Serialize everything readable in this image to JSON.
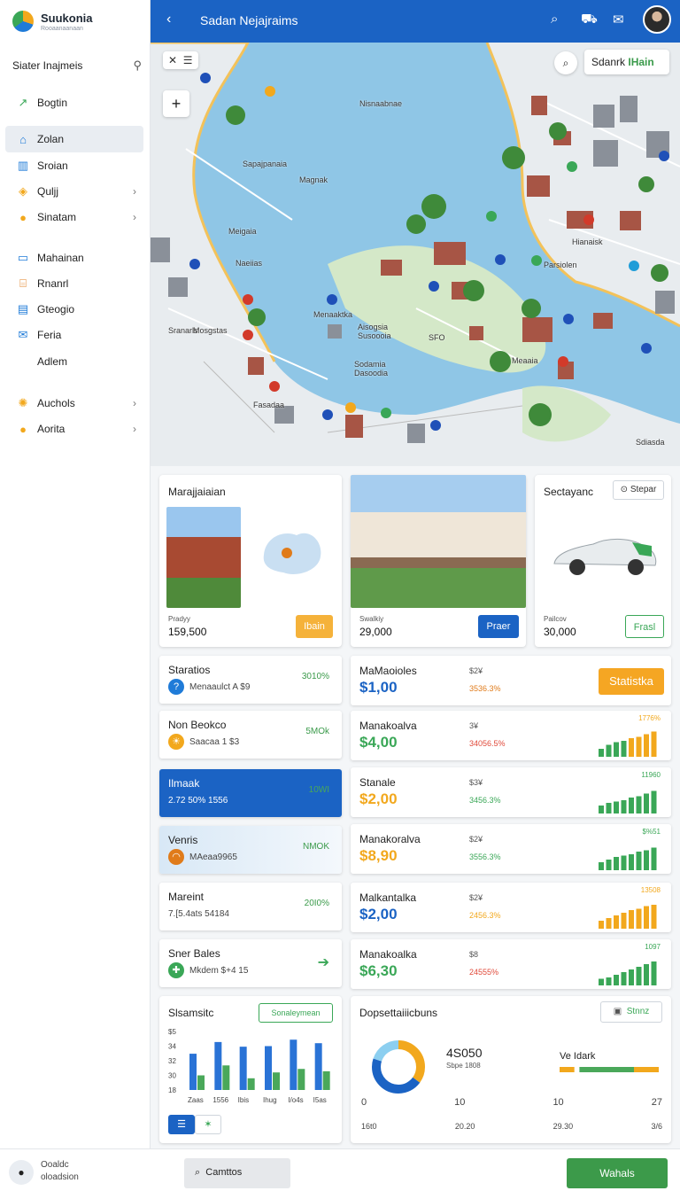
{
  "app": {
    "name": "Suukonia",
    "tagline": "Rooaanaanaan"
  },
  "sidebar": {
    "heading": "Siater Inajmeis",
    "items": [
      {
        "label": "Bogtin",
        "icon": "chart-icon",
        "icon_color": "#3aa757"
      },
      {
        "label": "Zolan",
        "icon": "home-icon",
        "icon_color": "#1f7bd8"
      },
      {
        "label": "Sroian",
        "icon": "building-icon",
        "icon_color": "#1f7bd8"
      },
      {
        "label": "Quljj",
        "icon": "location-icon",
        "icon_color": "#f2a81d"
      },
      {
        "label": "Sinatam",
        "icon": "pin-icon",
        "icon_color": "#f2a81d"
      },
      {
        "label": "Mahainan",
        "icon": "monitor-icon",
        "icon_color": "#1f7bd8"
      },
      {
        "label": "Rnanrl",
        "icon": "bank-icon",
        "icon_color": "#e07b1a"
      },
      {
        "label": "Gteogio",
        "icon": "document-icon",
        "icon_color": "#1f7bd8"
      },
      {
        "label": "Feria",
        "icon": "mail-icon",
        "icon_color": "#1f7bd8"
      },
      {
        "label": "Adlem",
        "icon": "",
        "icon_color": ""
      },
      {
        "label": "Auchols",
        "icon": "group-icon",
        "icon_color": "#f2a81d"
      },
      {
        "label": "Aorita",
        "icon": "pin-icon",
        "icon_color": "#f2a81d"
      }
    ]
  },
  "topbar": {
    "title": "Sadan Nejajraims"
  },
  "map": {
    "search_text": "Sdanrk",
    "search_accent": "IHain",
    "labels": [
      "Nisnaabnae",
      "Sapajpanaia",
      "Magnak",
      "Meigaia",
      "Naeiias",
      "Mosgstas",
      "Sranarls",
      "Parsiolen",
      "Menaaktka",
      "Aisogsia Susoooia",
      "SFO",
      "Sodamia Dasoodia",
      "Meaaia",
      "Sdiasda",
      "Hianaisk",
      "Fasadaa"
    ]
  },
  "cards": [
    {
      "title": "Marajjaiaian",
      "label": "Pradyy",
      "price": "159,500",
      "button": "Ibain"
    },
    {
      "title": "",
      "label": "Swalkiy",
      "price": "29,000",
      "button": "Praer"
    },
    {
      "title": "Sectayanc",
      "chip": "Stepar",
      "label": "Pailcov",
      "price": "30,000",
      "button": "Frasl"
    }
  ],
  "left_stats": [
    {
      "title": "Staratios",
      "sub": "Menaaulct A $9",
      "value": "3010%",
      "icon": "question-icon",
      "color": "#1f7bd8"
    },
    {
      "title": "Non Beokco",
      "sub": "Saacaa 1 $3",
      "value": "5MOk",
      "icon": "sun-icon",
      "color": "#f2a81d"
    },
    {
      "title": "Ilmaak",
      "sub": "2.72 50% 1556",
      "value": "10WI",
      "icon": "",
      "color": "#1b63c4"
    },
    {
      "title": "Venris",
      "sub": "MAeaa9965",
      "value": "NMOK",
      "icon": "rainbow-icon",
      "color": "#e07b1a"
    },
    {
      "title": "Mareint",
      "sub": "7.[5.4ats 54184",
      "value": "20I0%",
      "icon": "",
      "color": ""
    },
    {
      "title": "Sner Bales",
      "sub": "Mkdem $+4 15",
      "value": "",
      "icon": "plus-icon",
      "color": "#3aa757"
    }
  ],
  "right_stats": [
    {
      "name": "MaMaoioles",
      "amount": "$1,00",
      "amount_color": "#1b63c4",
      "pct": "$2¥",
      "change": "3536.3%",
      "change_color": "#e07b1a",
      "action": "Statistka"
    },
    {
      "name": "Manakoalva",
      "amount": "$4,00",
      "amount_color": "#3aa757",
      "pct": "3¥",
      "change": "34056.5%",
      "change_color": "#e04a3a",
      "mini": "1776%",
      "mini_values": [
        0.3,
        0.45,
        0.55,
        0.6,
        0.7,
        0.75,
        0.85,
        0.95
      ],
      "mini_colors": [
        "#3aa757",
        "#3aa757",
        "#3aa757",
        "#3aa757",
        "#f2a81d",
        "#f2a81d",
        "#f2a81d",
        "#f2a81d"
      ]
    },
    {
      "name": "Stanale",
      "amount": "$2,00",
      "amount_color": "#f2a81d",
      "pct": "$3¥",
      "change": "3456.3%",
      "change_color": "#3aa757",
      "mini": "11960",
      "mini_values": [
        0.3,
        0.4,
        0.45,
        0.5,
        0.6,
        0.65,
        0.75,
        0.85
      ],
      "mini_colors": [
        "#3aa757",
        "#3aa757",
        "#3aa757",
        "#3aa757",
        "#3aa757",
        "#3aa757",
        "#3aa757",
        "#3aa757"
      ]
    },
    {
      "name": "Manakoralva",
      "amount": "$8,90",
      "amount_color": "#f2a81d",
      "pct": "$2¥",
      "change": "3556.3%",
      "change_color": "#3aa757",
      "mini": "$%51",
      "mini_values": [
        0.3,
        0.4,
        0.5,
        0.55,
        0.6,
        0.7,
        0.75,
        0.85
      ],
      "mini_colors": [
        "#3aa757",
        "#3aa757",
        "#3aa757",
        "#3aa757",
        "#3aa757",
        "#3aa757",
        "#3aa757",
        "#3aa757"
      ]
    },
    {
      "name": "Malkantalka",
      "amount": "$2,00",
      "amount_color": "#1b63c4",
      "pct": "$2¥",
      "change": "2456.3%",
      "change_color": "#f2a81d",
      "mini": "13508",
      "mini_values": [
        0.3,
        0.4,
        0.5,
        0.6,
        0.7,
        0.75,
        0.85,
        0.9
      ],
      "mini_colors": [
        "#f2a81d",
        "#f2a81d",
        "#f2a81d",
        "#f2a81d",
        "#f2a81d",
        "#f2a81d",
        "#f2a81d",
        "#f2a81d"
      ]
    },
    {
      "name": "Manakoalka",
      "amount": "$6,30",
      "amount_color": "#3aa757",
      "pct": "$8",
      "change": "24555%",
      "change_color": "#e04a3a",
      "mini": "1097",
      "mini_values": [
        0.25,
        0.3,
        0.4,
        0.5,
        0.6,
        0.7,
        0.8,
        0.9
      ],
      "mini_colors": [
        "#3aa757",
        "#3aa757",
        "#3aa757",
        "#3aa757",
        "#3aa757",
        "#3aa757",
        "#3aa757",
        "#3aa757"
      ]
    }
  ],
  "chart_data": [
    {
      "type": "bar",
      "title": "Slsamsitc",
      "button": "Sonaleymean",
      "categories": [
        "Zaas",
        "1556",
        "Ibis",
        "Ihug",
        "I/o4s",
        "I5as"
      ],
      "y_ticks": [
        "$5",
        "34",
        "32",
        "30",
        "18"
      ],
      "ylim": [
        0,
        100
      ],
      "series": [
        {
          "values": [
            62,
            82,
            74,
            75,
            86,
            80
          ],
          "color": "#2a73d6"
        },
        {
          "values": [
            25,
            42,
            20,
            30,
            36,
            32
          ],
          "color": "#4aa85a"
        }
      ]
    },
    {
      "type": "pie",
      "title": "Dopsettaiiicbuns",
      "button": "Stnnz",
      "center_value": "4S050",
      "center_sub": "Sbpe 1808",
      "slices": [
        {
          "value": 35,
          "color": "#f2a81d"
        },
        {
          "value": 45,
          "color": "#1b63c4"
        },
        {
          "value": 20,
          "color": "#8ccff0"
        }
      ],
      "legend_label": "Ve Idark",
      "bar_segments": [
        {
          "value": 15,
          "color": "#f2a81d"
        },
        {
          "value": 5,
          "color": "#ffffff"
        },
        {
          "value": 55,
          "color": "#4aa85a"
        },
        {
          "value": 25,
          "color": "#f2a81d"
        }
      ],
      "axis_top": [
        "0",
        "10",
        "10",
        "27"
      ],
      "axis_bottom": [
        "16t0",
        "20.20",
        "29.30",
        "3/6"
      ]
    }
  ],
  "bottom": {
    "status_title": "Ooaldc",
    "status_sub": "oloadsion",
    "search": "Camttos",
    "action": "Wahals"
  }
}
